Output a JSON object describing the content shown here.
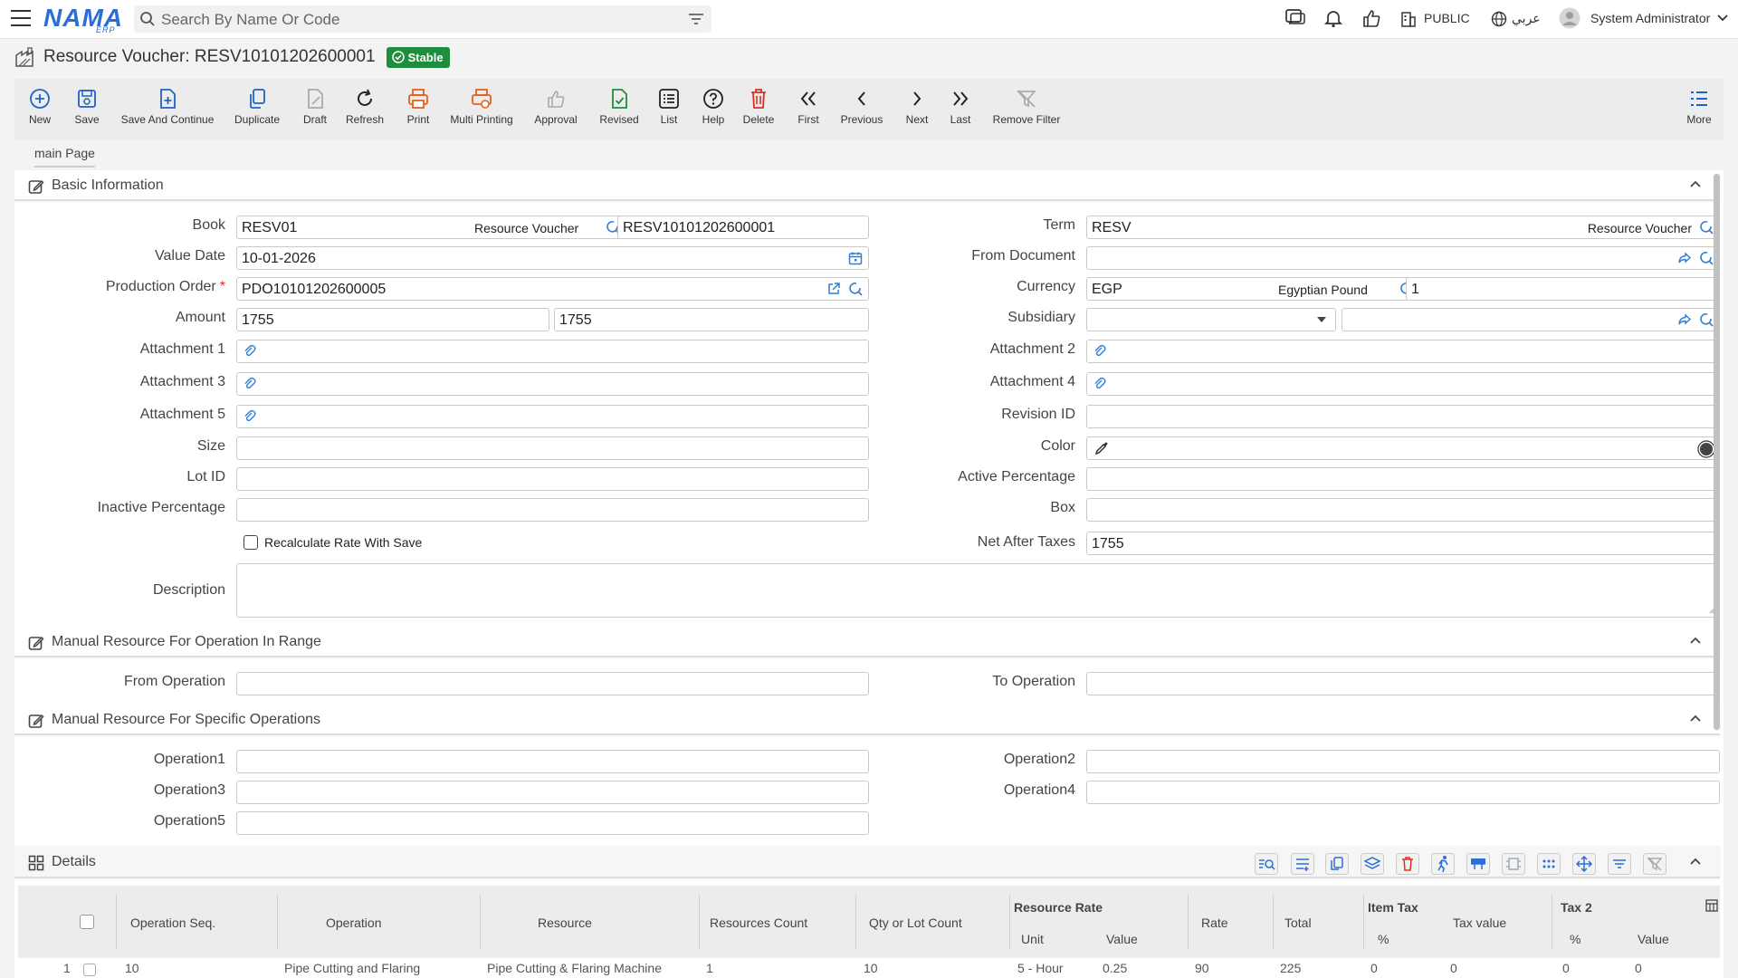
{
  "app": {
    "logo": "NAMA",
    "logo_sub": "ERP",
    "search_placeholder": "Search By Name Or Code",
    "scope": "PUBLIC",
    "language": "عربي",
    "user": "System Administrator"
  },
  "page": {
    "title": "Resource Voucher: RESV10101202600001",
    "status": "Stable"
  },
  "toolbar": {
    "new": "New",
    "save": "Save",
    "save_continue": "Save And Continue",
    "duplicate": "Duplicate",
    "draft": "Draft",
    "refresh": "Refresh",
    "print": "Print",
    "multi_printing": "Multi Printing",
    "approval": "Approval",
    "revised": "Revised",
    "list": "List",
    "help": "Help",
    "delete": "Delete",
    "first": "First",
    "previous": "Previous",
    "next": "Next",
    "last": "Last",
    "remove_filter": "Remove Filter",
    "more": "More"
  },
  "tabs": {
    "main": "main Page"
  },
  "sections": {
    "basic": "Basic Information",
    "range": "Manual Resource For Operation In Range",
    "specific": "Manual Resource For Specific Operations",
    "details": "Details"
  },
  "form": {
    "book_label": "Book",
    "book": "RESV01",
    "book_tag": "Resource Voucher",
    "book_code": "RESV10101202600001",
    "term_label": "Term",
    "term": "RESV",
    "term_tag": "Resource Voucher",
    "value_date_label": "Value Date",
    "value_date": "10-01-2026",
    "from_document_label": "From Document",
    "production_order_label": "Production Order",
    "production_order": "PDO10101202600005",
    "currency_label": "Currency",
    "currency": "EGP",
    "currency_tag": "Egyptian Pound",
    "currency_rate": "1",
    "amount_label": "Amount",
    "amount": "1755",
    "amount2": "1755",
    "subsidiary_label": "Subsidiary",
    "att1_label": "Attachment 1",
    "att2_label": "Attachment 2",
    "att3_label": "Attachment 3",
    "att4_label": "Attachment 4",
    "att5_label": "Attachment 5",
    "revision_label": "Revision ID",
    "size_label": "Size",
    "color_label": "Color",
    "lot_label": "Lot ID",
    "active_pct_label": "Active Percentage",
    "inactive_pct_label": "Inactive Percentage",
    "box_label": "Box",
    "recalc_label": "Recalculate Rate With Save",
    "net_after_taxes_label": "Net After Taxes",
    "net_after_taxes": "1755",
    "description_label": "Description",
    "from_operation_label": "From Operation",
    "to_operation_label": "To Operation",
    "op1": "Operation1",
    "op2": "Operation2",
    "op3": "Operation3",
    "op4": "Operation4",
    "op5": "Operation5"
  },
  "grid": {
    "headers": {
      "op_seq": "Operation Seq.",
      "operation": "Operation",
      "resource": "Resource",
      "resources_count": "Resources Count",
      "qty_lot": "Qty or Lot Count",
      "resource_rate": "Resource Rate",
      "unit": "Unit",
      "value": "Value",
      "rate": "Rate",
      "total": "Total",
      "item_tax": "Item Tax",
      "pct": "%",
      "tax_value": "Tax value",
      "tax2": "Tax 2",
      "pct2": "%",
      "value2": "Value"
    },
    "row": {
      "num": "1",
      "op_seq": "10",
      "operation": "Pipe Cutting and Flaring",
      "resource": "Pipe Cutting & Flaring Machine",
      "resources_count": "1",
      "qty_lot": "10",
      "unit": "5 - Hour",
      "value": "0.25",
      "rate": "90",
      "total": "225",
      "item_tax_pct": "0",
      "tax_value": "0",
      "tax2_pct": "0",
      "tax2_value": "0"
    }
  }
}
